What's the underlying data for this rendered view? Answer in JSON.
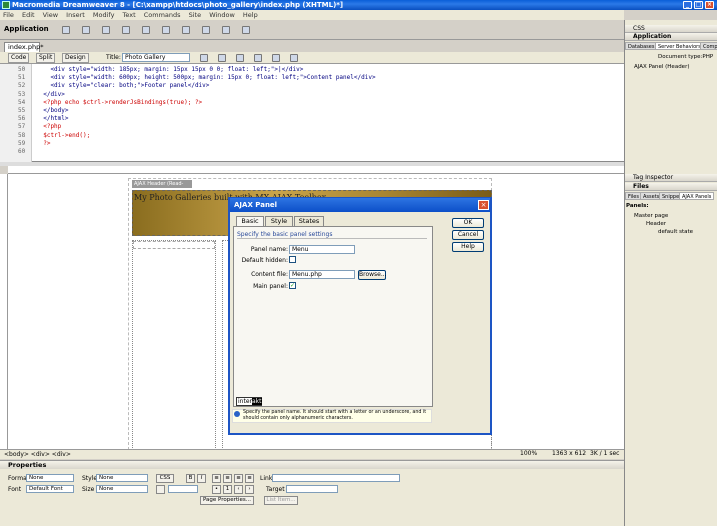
{
  "window": {
    "title": "Macromedia Dreamweaver 8 - [C:\\xampp\\htdocs\\photo_gallery\\index.php (XHTML)*]"
  },
  "menu": [
    "File",
    "Edit",
    "View",
    "Insert",
    "Modify",
    "Text",
    "Commands",
    "Site",
    "Window",
    "Help"
  ],
  "insert_bar": {
    "category": "Application"
  },
  "document": {
    "tab": "index.php*",
    "views": [
      "Code",
      "Split",
      "Design"
    ],
    "title_label": "Title:",
    "title_value": "Photo Gallery"
  },
  "code": {
    "lines": [
      {
        "n": "50",
        "text": "    <div style=\"width: 185px; margin: 15px 15px 0 0; float: left;\">|</div>",
        "kind": "tag"
      },
      {
        "n": "51",
        "text": "    <div style=\"width: 600px; height: 500px; margin: 15px 0; float: left;\">Content panel</div>",
        "kind": "tag"
      },
      {
        "n": "52",
        "text": "    <div style=\"clear: both;\">Footer panel</div>",
        "kind": "tag"
      },
      {
        "n": "53",
        "text": "  </div>",
        "kind": "tag"
      },
      {
        "n": "54",
        "text": "  <?php echo $ctrl->renderJsBindings(true); ?>",
        "kind": "php"
      },
      {
        "n": "55",
        "text": "  </body>",
        "kind": "tag"
      },
      {
        "n": "56",
        "text": "  </html>",
        "kind": "tag"
      },
      {
        "n": "57",
        "text": "  <?php",
        "kind": "php"
      },
      {
        "n": "58",
        "text": "  $ctrl->end();",
        "kind": "php"
      },
      {
        "n": "59",
        "text": "  ?>",
        "kind": "php"
      },
      {
        "n": "60",
        "text": "",
        "kind": "tag"
      }
    ]
  },
  "design": {
    "header_label": "AJAX Header (Read-only)",
    "header_text": "My Photo Galleries built with MX AJAX Toolbox"
  },
  "tagbar": {
    "path": "<body> <div> <div>",
    "zoom": "100%",
    "size": "1363 x 612",
    "weight": "3K / 1 sec"
  },
  "properties": {
    "title": "Properties",
    "format_label": "Format",
    "format_value": "None",
    "style_label": "Style",
    "style_value": "None",
    "css_label": "CSS",
    "font_label": "Font",
    "font_value": "Default Font",
    "size_label": "Size",
    "size_value": "None",
    "link_label": "Link",
    "target_label": "Target",
    "page_properties": "Page Properties...",
    "list_item": "List Item..."
  },
  "right_panels": {
    "css": "CSS",
    "application": "Application",
    "app_tabs": [
      "Databases",
      "Server Behaviors",
      "Comp"
    ],
    "doc_type": "Document type:PHP",
    "behavior_item": "AJAX Panel (Header)",
    "tag_inspector": "Tag Inspector",
    "files": "Files",
    "file_tabs": [
      "Files",
      "Assets",
      "Snippets",
      "AJAX Panels"
    ],
    "panels_label": "Panels:",
    "tree": [
      "Master page",
      "Header",
      "default state"
    ]
  },
  "dialog": {
    "title": "AJAX Panel",
    "tabs": [
      "Basic",
      "Style",
      "States"
    ],
    "heading": "Specify the basic panel settings",
    "panel_name_label": "Panel name:",
    "panel_name_value": "Menu",
    "default_hidden_label": "Default hidden:",
    "content_file_label": "Content file:",
    "content_file_value": "Menu.php",
    "browse": "Browse...",
    "main_panel_label": "Main panel:",
    "ok": "OK",
    "cancel": "Cancel",
    "help": "Help",
    "interakt_prefix": "inter",
    "interakt_highlight": "akt",
    "hint": "Specify the panel name. It should start with a letter or an underscore, and it should contain only alphanumeric characters."
  },
  "colors": {
    "accent": "#0a5fd8",
    "header_gold": "#c9a44a"
  }
}
